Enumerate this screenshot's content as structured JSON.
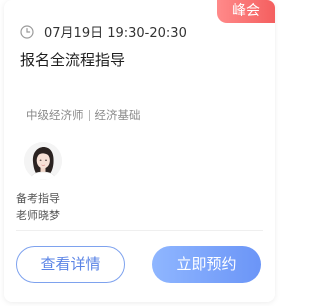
{
  "badge": "峰会",
  "schedule": {
    "icon": "clock-icon",
    "time": "07月19日 19:30-20:30"
  },
  "title": "报名全流程指导",
  "tags": [
    "中级经济师",
    "经济基础"
  ],
  "teacher": {
    "role": "备考指导",
    "name": "老师晓梦"
  },
  "buttons": {
    "detail": "查看详情",
    "book": "立即预约"
  },
  "colors": {
    "badge": "#f45f5f",
    "primary": "#6b95f7",
    "outline": "#7ea2ee"
  }
}
